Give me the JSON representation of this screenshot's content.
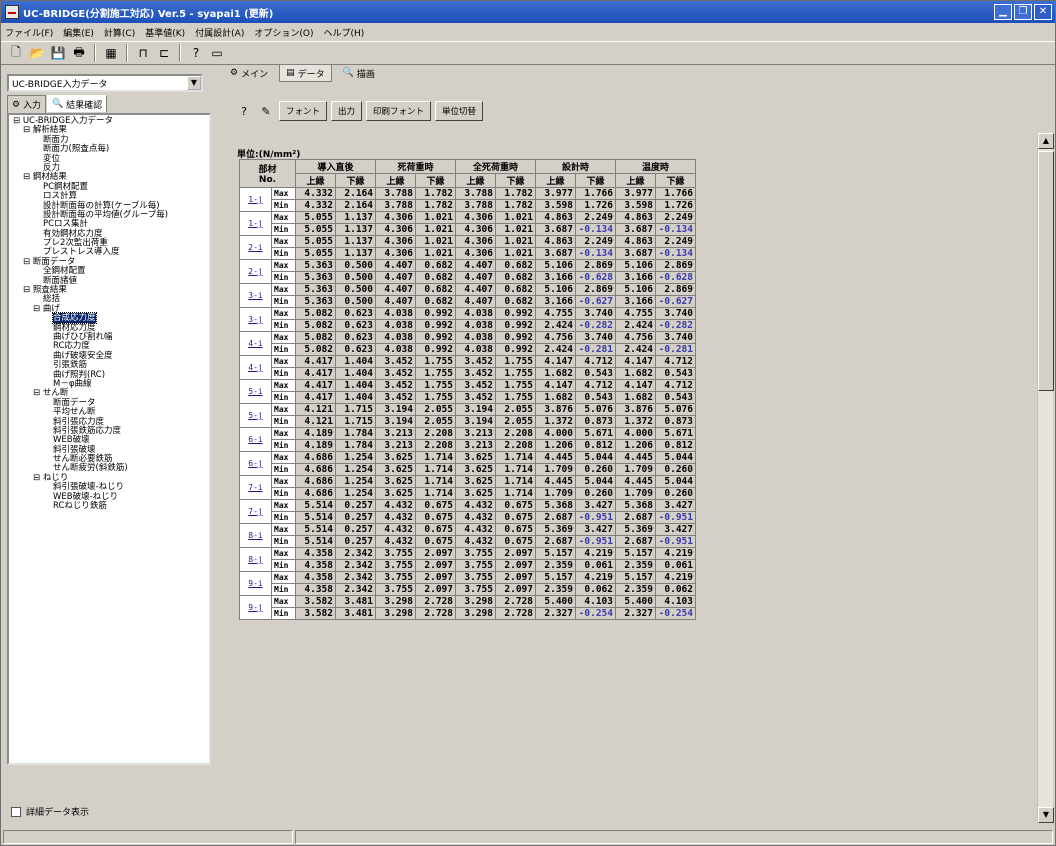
{
  "window": {
    "title": "UC-BRIDGE(分割施工対応) Ver.5 - syapai1 (更新)"
  },
  "menu": [
    "ファイル(F)",
    "編集(E)",
    "計算(C)",
    "基準値(K)",
    "付属設計(A)",
    "オプション(O)",
    "ヘルプ(H)"
  ],
  "left": {
    "combo_value": "UC-BRIDGE入力データ",
    "tabs": [
      "入力",
      "結果確認"
    ],
    "detail_label": "詳細データ表示",
    "tree": [
      {
        "t": "⊟ UC-BRIDGE入力データ",
        "i": 0
      },
      {
        "t": "⊟ 解析結果",
        "i": 1
      },
      {
        "t": "断面力",
        "i": 3
      },
      {
        "t": "断面力(照査点毎)",
        "i": 3
      },
      {
        "t": "変位",
        "i": 3
      },
      {
        "t": "反力",
        "i": 3
      },
      {
        "t": "⊟ 鋼材結果",
        "i": 1
      },
      {
        "t": "PC鋼材配置",
        "i": 3
      },
      {
        "t": "ロス計算",
        "i": 3
      },
      {
        "t": "設計断面毎の計算(ケーブル毎)",
        "i": 3
      },
      {
        "t": "設計断面毎の平均値(グループ毎)",
        "i": 3
      },
      {
        "t": "PCロス集計",
        "i": 3
      },
      {
        "t": "有効鋼材応力度",
        "i": 3
      },
      {
        "t": "プレ2次監出荷重",
        "i": 3
      },
      {
        "t": "プレストレス導入度",
        "i": 3
      },
      {
        "t": "⊟ 断面データ",
        "i": 1
      },
      {
        "t": "全鋼材配置",
        "i": 3
      },
      {
        "t": "断面諸値",
        "i": 3
      },
      {
        "t": "⊟ 照査結果",
        "i": 1
      },
      {
        "t": "総括",
        "i": 3
      },
      {
        "t": "⊟ 曲げ",
        "i": 2
      },
      {
        "t": "合成応力度",
        "i": 4,
        "sel": true
      },
      {
        "t": "鋼材応力度",
        "i": 4
      },
      {
        "t": "曲げひび割れ幅",
        "i": 4
      },
      {
        "t": "RC応力度",
        "i": 4
      },
      {
        "t": "曲げ破壊安全度",
        "i": 4
      },
      {
        "t": "引張鉄筋",
        "i": 4
      },
      {
        "t": "曲げ照判(RC)",
        "i": 4
      },
      {
        "t": "M－φ曲線",
        "i": 4
      },
      {
        "t": "⊟ せん断",
        "i": 2
      },
      {
        "t": "断面データ",
        "i": 4
      },
      {
        "t": "平均せん断",
        "i": 4
      },
      {
        "t": "斜引張応力度",
        "i": 4
      },
      {
        "t": "斜引張鉄筋応力度",
        "i": 4
      },
      {
        "t": "WEB破壊",
        "i": 4
      },
      {
        "t": "斜引張破壊",
        "i": 4
      },
      {
        "t": "せん断必要鉄筋",
        "i": 4
      },
      {
        "t": "せん断疲労(斜鉄筋)",
        "i": 4
      },
      {
        "t": "⊟ ねじり",
        "i": 2
      },
      {
        "t": "斜引張破壊-ねじり",
        "i": 4
      },
      {
        "t": "WEB破壊-ねじり",
        "i": 4
      },
      {
        "t": "RCねじり鉄筋",
        "i": 4
      }
    ]
  },
  "right": {
    "tabs": [
      "メイン",
      "データ",
      "描画"
    ],
    "buttons": [
      "フォント",
      "出力",
      "印刷フォント",
      "単位切替"
    ],
    "unit": "単位:(N/mm²)",
    "header": {
      "member": "部材\nNo.",
      "groups": [
        "導入直後",
        "死荷重時",
        "全死荷重時",
        "設計時",
        "温度時"
      ],
      "upper": "上縁",
      "lower": "下縁"
    },
    "rows": [
      {
        "m": "1-j",
        "max": [
          "4.332",
          "2.164",
          "3.788",
          "1.782",
          "3.788",
          "1.782",
          "3.977",
          "1.766",
          "3.977",
          "1.766"
        ],
        "min": [
          "4.332",
          "2.164",
          "3.788",
          "1.782",
          "3.788",
          "1.782",
          "3.598",
          "1.726",
          "3.598",
          "1.726"
        ]
      },
      {
        "m": "1-j",
        "max": [
          "5.055",
          "1.137",
          "4.306",
          "1.021",
          "4.306",
          "1.021",
          "4.863",
          "2.249",
          "4.863",
          "2.249"
        ],
        "min": [
          "5.055",
          "1.137",
          "4.306",
          "1.021",
          "4.306",
          "1.021",
          "3.687",
          "-0.134",
          "3.687",
          "-0.134"
        ]
      },
      {
        "m": "2-i",
        "max": [
          "5.055",
          "1.137",
          "4.306",
          "1.021",
          "4.306",
          "1.021",
          "4.863",
          "2.249",
          "4.863",
          "2.249"
        ],
        "min": [
          "5.055",
          "1.137",
          "4.306",
          "1.021",
          "4.306",
          "1.021",
          "3.687",
          "-0.134",
          "3.687",
          "-0.134"
        ]
      },
      {
        "m": "2-j",
        "max": [
          "5.363",
          "0.500",
          "4.407",
          "0.682",
          "4.407",
          "0.682",
          "5.106",
          "2.869",
          "5.106",
          "2.869"
        ],
        "min": [
          "5.363",
          "0.500",
          "4.407",
          "0.682",
          "4.407",
          "0.682",
          "3.166",
          "-0.628",
          "3.166",
          "-0.628"
        ]
      },
      {
        "m": "3-i",
        "max": [
          "5.363",
          "0.500",
          "4.407",
          "0.682",
          "4.407",
          "0.682",
          "5.106",
          "2.869",
          "5.106",
          "2.869"
        ],
        "min": [
          "5.363",
          "0.500",
          "4.407",
          "0.682",
          "4.407",
          "0.682",
          "3.166",
          "-0.627",
          "3.166",
          "-0.627"
        ]
      },
      {
        "m": "3-j",
        "max": [
          "5.082",
          "0.623",
          "4.038",
          "0.992",
          "4.038",
          "0.992",
          "4.755",
          "3.740",
          "4.755",
          "3.740"
        ],
        "min": [
          "5.082",
          "0.623",
          "4.038",
          "0.992",
          "4.038",
          "0.992",
          "2.424",
          "-0.282",
          "2.424",
          "-0.282"
        ]
      },
      {
        "m": "4-i",
        "max": [
          "5.082",
          "0.623",
          "4.038",
          "0.992",
          "4.038",
          "0.992",
          "4.756",
          "3.740",
          "4.756",
          "3.740"
        ],
        "min": [
          "5.082",
          "0.623",
          "4.038",
          "0.992",
          "4.038",
          "0.992",
          "2.424",
          "-0.281",
          "2.424",
          "-0.281"
        ]
      },
      {
        "m": "4-j",
        "max": [
          "4.417",
          "1.404",
          "3.452",
          "1.755",
          "3.452",
          "1.755",
          "4.147",
          "4.712",
          "4.147",
          "4.712"
        ],
        "min": [
          "4.417",
          "1.404",
          "3.452",
          "1.755",
          "3.452",
          "1.755",
          "1.682",
          "0.543",
          "1.682",
          "0.543"
        ]
      },
      {
        "m": "5-i",
        "max": [
          "4.417",
          "1.404",
          "3.452",
          "1.755",
          "3.452",
          "1.755",
          "4.147",
          "4.712",
          "4.147",
          "4.712"
        ],
        "min": [
          "4.417",
          "1.404",
          "3.452",
          "1.755",
          "3.452",
          "1.755",
          "1.682",
          "0.543",
          "1.682",
          "0.543"
        ]
      },
      {
        "m": "5-j",
        "max": [
          "4.121",
          "1.715",
          "3.194",
          "2.055",
          "3.194",
          "2.055",
          "3.876",
          "5.076",
          "3.876",
          "5.076"
        ],
        "min": [
          "4.121",
          "1.715",
          "3.194",
          "2.055",
          "3.194",
          "2.055",
          "1.372",
          "0.873",
          "1.372",
          "0.873"
        ]
      },
      {
        "m": "6-i",
        "max": [
          "4.189",
          "1.784",
          "3.213",
          "2.208",
          "3.213",
          "2.208",
          "4.000",
          "5.671",
          "4.000",
          "5.671"
        ],
        "min": [
          "4.189",
          "1.784",
          "3.213",
          "2.208",
          "3.213",
          "2.208",
          "1.206",
          "0.812",
          "1.206",
          "0.812"
        ]
      },
      {
        "m": "6-j",
        "max": [
          "4.686",
          "1.254",
          "3.625",
          "1.714",
          "3.625",
          "1.714",
          "4.445",
          "5.044",
          "4.445",
          "5.044"
        ],
        "min": [
          "4.686",
          "1.254",
          "3.625",
          "1.714",
          "3.625",
          "1.714",
          "1.709",
          "0.260",
          "1.709",
          "0.260"
        ]
      },
      {
        "m": "7-i",
        "max": [
          "4.686",
          "1.254",
          "3.625",
          "1.714",
          "3.625",
          "1.714",
          "4.445",
          "5.044",
          "4.445",
          "5.044"
        ],
        "min": [
          "4.686",
          "1.254",
          "3.625",
          "1.714",
          "3.625",
          "1.714",
          "1.709",
          "0.260",
          "1.709",
          "0.260"
        ]
      },
      {
        "m": "7-j",
        "max": [
          "5.514",
          "0.257",
          "4.432",
          "0.675",
          "4.432",
          "0.675",
          "5.368",
          "3.427",
          "5.368",
          "3.427"
        ],
        "min": [
          "5.514",
          "0.257",
          "4.432",
          "0.675",
          "4.432",
          "0.675",
          "2.687",
          "-0.951",
          "2.687",
          "-0.951"
        ]
      },
      {
        "m": "8-i",
        "max": [
          "5.514",
          "0.257",
          "4.432",
          "0.675",
          "4.432",
          "0.675",
          "5.369",
          "3.427",
          "5.369",
          "3.427"
        ],
        "min": [
          "5.514",
          "0.257",
          "4.432",
          "0.675",
          "4.432",
          "0.675",
          "2.687",
          "-0.951",
          "2.687",
          "-0.951"
        ]
      },
      {
        "m": "8-j",
        "max": [
          "4.358",
          "2.342",
          "3.755",
          "2.097",
          "3.755",
          "2.097",
          "5.157",
          "4.219",
          "5.157",
          "4.219"
        ],
        "min": [
          "4.358",
          "2.342",
          "3.755",
          "2.097",
          "3.755",
          "2.097",
          "2.359",
          "0.061",
          "2.359",
          "0.061"
        ]
      },
      {
        "m": "9-i",
        "max": [
          "4.358",
          "2.342",
          "3.755",
          "2.097",
          "3.755",
          "2.097",
          "5.157",
          "4.219",
          "5.157",
          "4.219"
        ],
        "min": [
          "4.358",
          "2.342",
          "3.755",
          "2.097",
          "3.755",
          "2.097",
          "2.359",
          "0.062",
          "2.359",
          "0.062"
        ]
      },
      {
        "m": "9-j",
        "max": [
          "3.582",
          "3.481",
          "3.298",
          "2.728",
          "3.298",
          "2.728",
          "5.400",
          "4.103",
          "5.400",
          "4.103"
        ],
        "min": [
          "3.582",
          "3.481",
          "3.298",
          "2.728",
          "3.298",
          "2.728",
          "2.327",
          "-0.254",
          "2.327",
          "-0.254"
        ]
      }
    ],
    "max_label": "Max",
    "min_label": "Min"
  }
}
